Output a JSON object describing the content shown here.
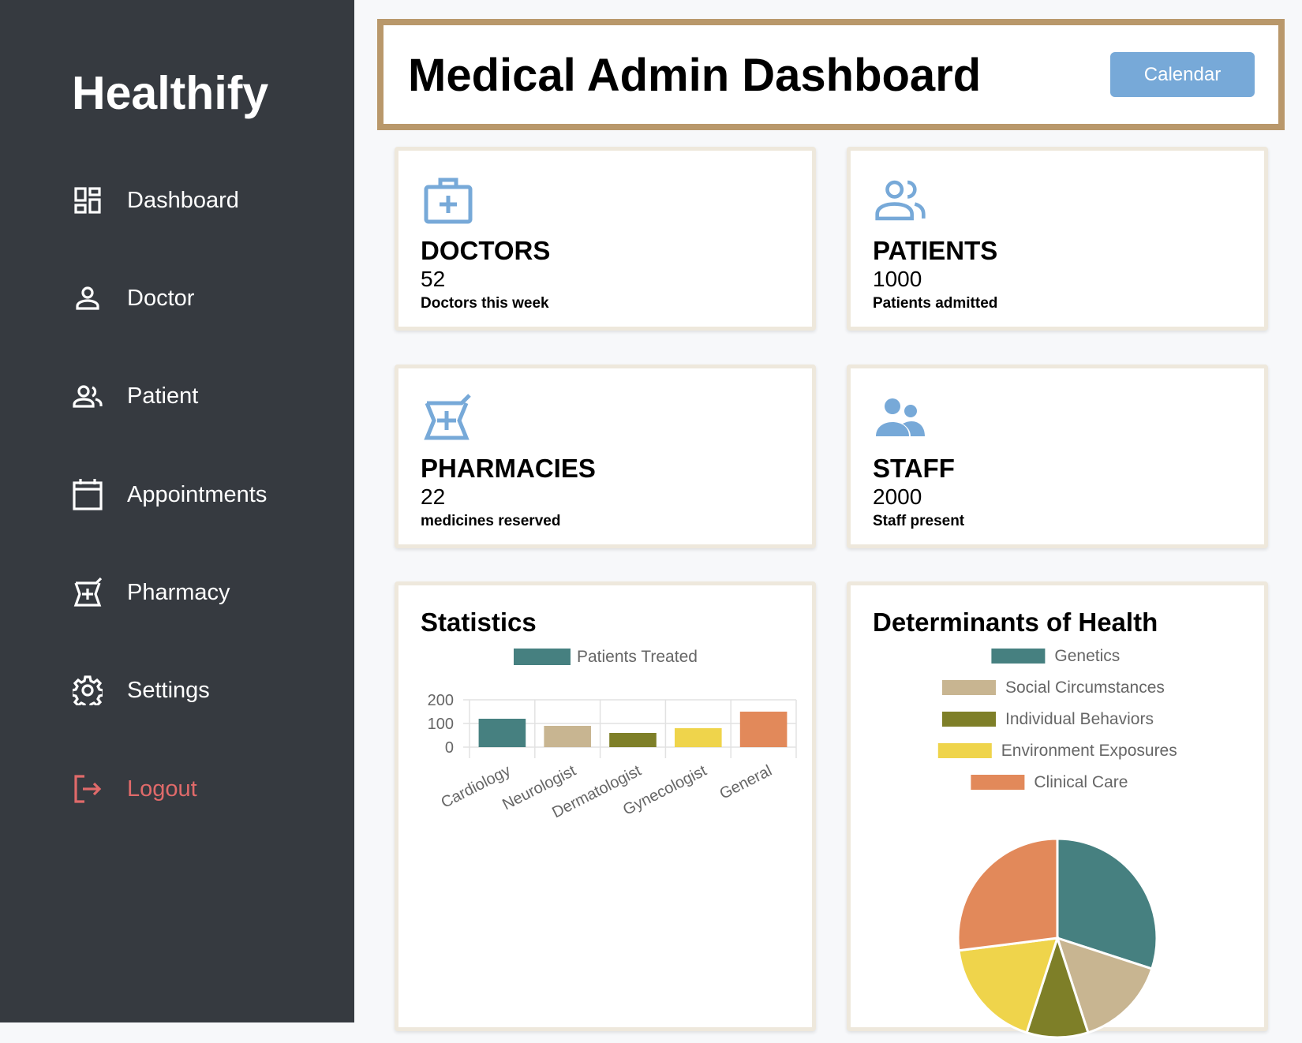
{
  "sidebar": {
    "brand": "Healthify",
    "items": [
      {
        "label": "Dashboard",
        "icon": "dashboard-icon"
      },
      {
        "label": "Doctor",
        "icon": "person-icon"
      },
      {
        "label": "Patient",
        "icon": "users-icon"
      },
      {
        "label": "Appointments",
        "icon": "calendar-icon"
      },
      {
        "label": "Pharmacy",
        "icon": "pharmacy-icon"
      },
      {
        "label": "Settings",
        "icon": "gear-icon"
      },
      {
        "label": "Logout",
        "icon": "logout-icon"
      }
    ],
    "logout_color": "#e06a6a"
  },
  "header": {
    "title": "Medical Admin Dashboard",
    "calendar_label": "Calendar"
  },
  "cards": [
    {
      "title": "DOCTORS",
      "value": "52",
      "sub": "Doctors this week",
      "icon": "medical-kit-icon"
    },
    {
      "title": "PATIENTS",
      "value": "1000",
      "sub": "Patients admitted",
      "icon": "patients-icon"
    },
    {
      "title": "PHARMACIES",
      "value": "22",
      "sub": "medicines reserved",
      "icon": "pharmacy-icon"
    },
    {
      "title": "STAFF",
      "value": "2000",
      "sub": "Staff present",
      "icon": "staff-icon"
    }
  ],
  "colors": {
    "accent": "#77a9d8",
    "header_border": "#b9986b",
    "sidebar_bg": "#363a40"
  },
  "chart_data": [
    {
      "type": "bar",
      "title": "Statistics",
      "categories": [
        "Cardiology",
        "Neurologist",
        "Dermatologist",
        "Gynecologist",
        "General"
      ],
      "series": [
        {
          "name": "Patients Treated",
          "values": [
            120,
            90,
            60,
            80,
            150
          ]
        }
      ],
      "colors": [
        "#468080",
        "#c8b591",
        "#7e7f28",
        "#efd44b",
        "#e2895a"
      ],
      "ylim": [
        0,
        200
      ],
      "yticks": [
        0,
        100,
        200
      ],
      "legend": "top"
    },
    {
      "type": "pie",
      "title": "Determinants of Health",
      "labels": [
        "Genetics",
        "Social Circumstances",
        "Individual Behaviors",
        "Environment Exposures",
        "Clinical Care"
      ],
      "values": [
        30,
        15,
        10,
        18,
        27
      ],
      "colors": [
        "#468080",
        "#c8b591",
        "#7e7f28",
        "#efd44b",
        "#e2895a"
      ],
      "legend": "top"
    }
  ]
}
